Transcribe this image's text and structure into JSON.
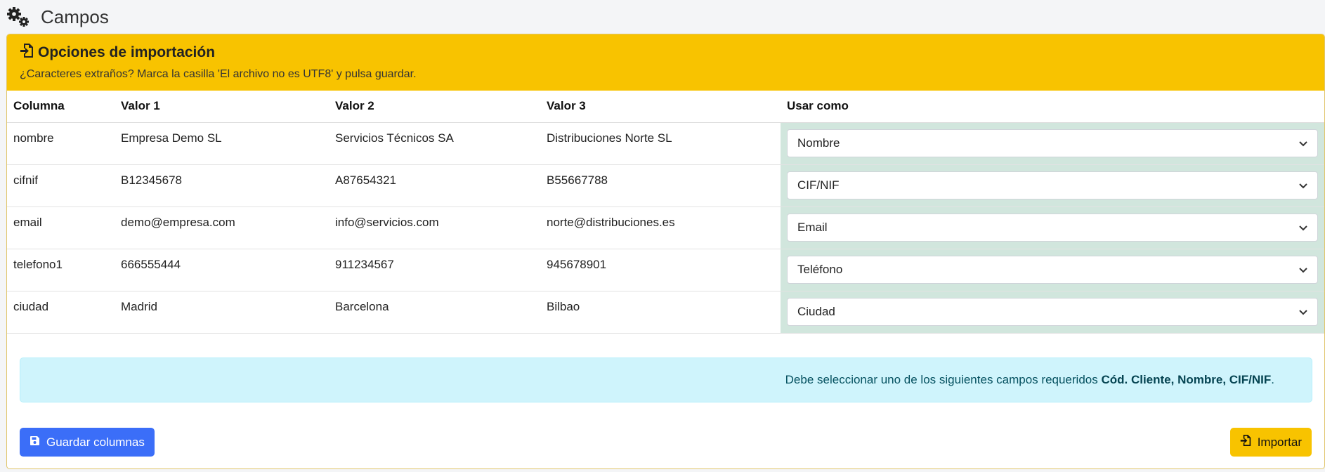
{
  "page": {
    "title": "Campos",
    "icon": "cogs-icon"
  },
  "card": {
    "title": "Opciones de importación",
    "hint": "¿Caracteres extraños? Marca la casilla 'El archivo no es UTF8' y pulsa guardar.",
    "accent": "#f8c300"
  },
  "table": {
    "headers": [
      "Columna",
      "Valor 1",
      "Valor 2",
      "Valor 3",
      "Usar como"
    ],
    "rows": [
      {
        "columna": "nombre",
        "v1": "Empresa Demo SL",
        "v2": "Servicios Técnicos SA",
        "v3": "Distribuciones Norte SL",
        "usar": "Nombre"
      },
      {
        "columna": "cifnif",
        "v1": "B12345678",
        "v2": "A87654321",
        "v3": "B55667788",
        "usar": "CIF/NIF"
      },
      {
        "columna": "email",
        "v1": "demo@empresa.com",
        "v2": "info@servicios.com",
        "v3": "norte@distribuciones.es",
        "usar": "Email"
      },
      {
        "columna": "telefono1",
        "v1": "666555444",
        "v2": "911234567",
        "v3": "945678901",
        "usar": "Teléfono"
      },
      {
        "columna": "ciudad",
        "v1": "Madrid",
        "v2": "Barcelona",
        "v3": "Bilbao",
        "usar": "Ciudad"
      }
    ]
  },
  "alert": {
    "text": "Debe seleccionar uno de los siguientes campos requeridos ",
    "required": "Cód. Cliente, Nombre, CIF/NIF",
    "suffix": "."
  },
  "buttons": {
    "save": "Guardar columnas",
    "import": "Importar"
  }
}
